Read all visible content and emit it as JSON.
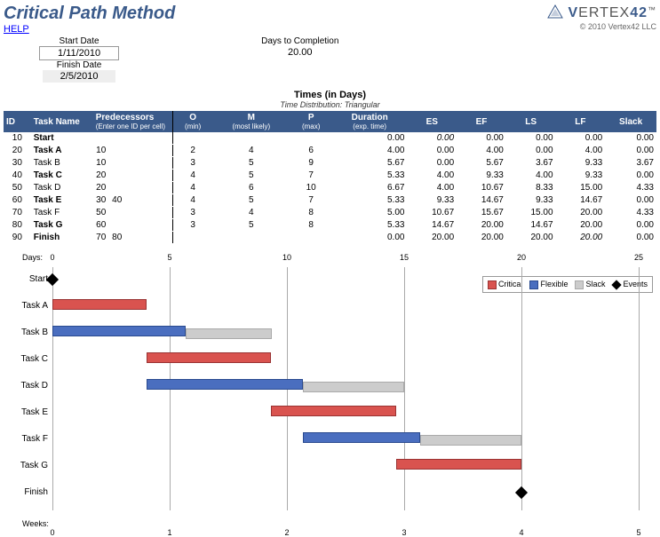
{
  "header": {
    "title": "Critical Path Method",
    "help": "HELP",
    "brand_prefix": "V",
    "brand_rest": "ERTEX",
    "brand_suffix": "42",
    "tm": "™",
    "copyright": "© 2010 Vertex42 LLC"
  },
  "meta": {
    "start_date_label": "Start Date",
    "start_date": "1/11/2010",
    "finish_date_label": "Finish Date",
    "finish_date": "2/5/2010",
    "days_label": "Days to Completion",
    "days": "20.00"
  },
  "table": {
    "section_title": "Times (in Days)",
    "section_sub": "Time Distribution:   Triangular",
    "cols": {
      "id": "ID",
      "task": "Task Name",
      "pred": "Predecessors",
      "pred_sub": "(Enter one ID per cell)",
      "o": "O",
      "o_sub": "(min)",
      "m": "M",
      "m_sub": "(most likely)",
      "p": "P",
      "p_sub": "(max)",
      "dur": "Duration",
      "dur_sub": "(exp. time)",
      "es": "ES",
      "ef": "EF",
      "ls": "LS",
      "lf": "LF",
      "slack": "Slack"
    },
    "rows": [
      {
        "id": "10",
        "name": "Start",
        "bold": true,
        "pred": [
          "",
          "",
          "",
          "",
          ""
        ],
        "o": "",
        "m": "",
        "p": "",
        "dur": "0.00",
        "es": "0.00",
        "es_i": true,
        "ef": "0.00",
        "ls": "0.00",
        "lf": "0.00",
        "slack": "0.00"
      },
      {
        "id": "20",
        "name": "Task A",
        "bold": true,
        "pred": [
          "10",
          "",
          "",
          "",
          ""
        ],
        "o": "2",
        "m": "4",
        "p": "6",
        "dur": "4.00",
        "es": "0.00",
        "ef": "4.00",
        "ls": "0.00",
        "lf": "4.00",
        "slack": "0.00"
      },
      {
        "id": "30",
        "name": "Task B",
        "pred": [
          "10",
          "",
          "",
          "",
          ""
        ],
        "o": "3",
        "m": "5",
        "p": "9",
        "dur": "5.67",
        "es": "0.00",
        "ef": "5.67",
        "ls": "3.67",
        "lf": "9.33",
        "slack": "3.67"
      },
      {
        "id": "40",
        "name": "Task C",
        "bold": true,
        "pred": [
          "20",
          "",
          "",
          "",
          ""
        ],
        "o": "4",
        "m": "5",
        "p": "7",
        "dur": "5.33",
        "es": "4.00",
        "ef": "9.33",
        "ls": "4.00",
        "lf": "9.33",
        "slack": "0.00"
      },
      {
        "id": "50",
        "name": "Task D",
        "pred": [
          "20",
          "",
          "",
          "",
          ""
        ],
        "o": "4",
        "m": "6",
        "p": "10",
        "dur": "6.67",
        "es": "4.00",
        "ef": "10.67",
        "ls": "8.33",
        "lf": "15.00",
        "slack": "4.33"
      },
      {
        "id": "60",
        "name": "Task E",
        "bold": true,
        "pred": [
          "30",
          "40",
          "",
          "",
          ""
        ],
        "o": "4",
        "m": "5",
        "p": "7",
        "dur": "5.33",
        "es": "9.33",
        "ef": "14.67",
        "ls": "9.33",
        "lf": "14.67",
        "slack": "0.00"
      },
      {
        "id": "70",
        "name": "Task F",
        "pred": [
          "50",
          "",
          "",
          "",
          ""
        ],
        "o": "3",
        "m": "4",
        "p": "8",
        "dur": "5.00",
        "es": "10.67",
        "ef": "15.67",
        "ls": "15.00",
        "lf": "20.00",
        "slack": "4.33"
      },
      {
        "id": "80",
        "name": "Task G",
        "bold": true,
        "pred": [
          "60",
          "",
          "",
          "",
          ""
        ],
        "o": "3",
        "m": "5",
        "p": "8",
        "dur": "5.33",
        "es": "14.67",
        "ef": "20.00",
        "ls": "14.67",
        "lf": "20.00",
        "slack": "0.00"
      },
      {
        "id": "90",
        "name": "Finish",
        "bold": true,
        "pred": [
          "70",
          "80",
          "",
          "",
          ""
        ],
        "o": "",
        "m": "",
        "p": "",
        "dur": "0.00",
        "es": "20.00",
        "ef": "20.00",
        "ls": "20.00",
        "lf": "20.00",
        "lf_i": true,
        "slack": "0.00"
      }
    ]
  },
  "chart_data": {
    "type": "bar",
    "x_axis_top_label": "Days:",
    "x_axis_bot_label": "Weeks:",
    "x_ticks_days": [
      0,
      5,
      10,
      15,
      20,
      25
    ],
    "x_ticks_weeks": [
      0,
      1,
      2,
      3,
      4,
      5
    ],
    "xmax": 25,
    "legend": {
      "critical": "Critical",
      "flexible": "Flexible",
      "slack": "Slack",
      "events": "Events"
    },
    "rows": [
      {
        "label": "Start",
        "event_at": 0
      },
      {
        "label": "Task A",
        "critical": {
          "start": 0,
          "len": 4
        }
      },
      {
        "label": "Task B",
        "flexible": {
          "start": 0,
          "len": 5.67
        },
        "slack": {
          "start": 5.67,
          "len": 3.67
        }
      },
      {
        "label": "Task C",
        "critical": {
          "start": 4,
          "len": 5.33
        }
      },
      {
        "label": "Task D",
        "flexible": {
          "start": 4,
          "len": 6.67
        },
        "slack": {
          "start": 10.67,
          "len": 4.33
        }
      },
      {
        "label": "Task E",
        "critical": {
          "start": 9.33,
          "len": 5.33
        }
      },
      {
        "label": "Task F",
        "flexible": {
          "start": 10.67,
          "len": 5
        },
        "slack": {
          "start": 15.67,
          "len": 4.33
        }
      },
      {
        "label": "Task G",
        "critical": {
          "start": 14.67,
          "len": 5.33
        }
      },
      {
        "label": "Finish",
        "event_at": 20
      }
    ]
  }
}
